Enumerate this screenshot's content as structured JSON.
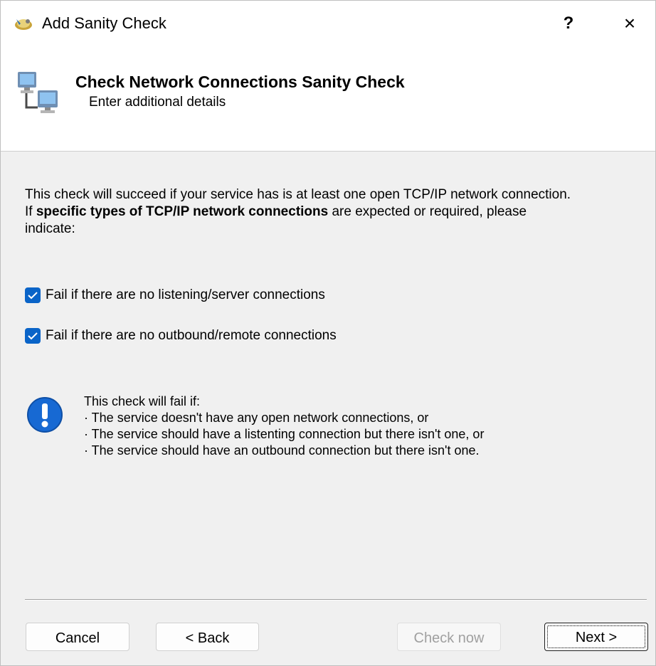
{
  "window": {
    "title": "Add Sanity Check",
    "help_label": "?",
    "close_label": "×"
  },
  "header": {
    "title": "Check Network Connections Sanity Check",
    "subtitle": "Enter additional details"
  },
  "description": {
    "line1": "This check will succeed if your service has is at least one open TCP/IP network connection.",
    "line2_prefix": "If ",
    "line2_bold": "specific types of TCP/IP network connections",
    "line2_suffix": " are expected or required, please",
    "line3": "indicate:"
  },
  "options": [
    {
      "label": "Fail if there are no listening/server connections",
      "checked": true
    },
    {
      "label": "Fail if there are no outbound/remote connections",
      "checked": true
    }
  ],
  "info": {
    "heading": "This check will fail if:",
    "bullets": [
      "· The service doesn't have any open network connections, or",
      "· The service should have a listenting connection but there isn't one, or",
      "· The service should have an outbound connection but there isn't one."
    ]
  },
  "buttons": {
    "cancel": "Cancel",
    "back": "< Back",
    "check_now": "Check now",
    "next": "Next >"
  },
  "colors": {
    "accent": "#0a64c8",
    "info_icon": "#1769d3"
  },
  "icons": {
    "app": "sanity-check-app-icon",
    "network": "network-computers-icon",
    "info": "exclamation-info-icon",
    "checkbox": "checkmark-icon"
  }
}
